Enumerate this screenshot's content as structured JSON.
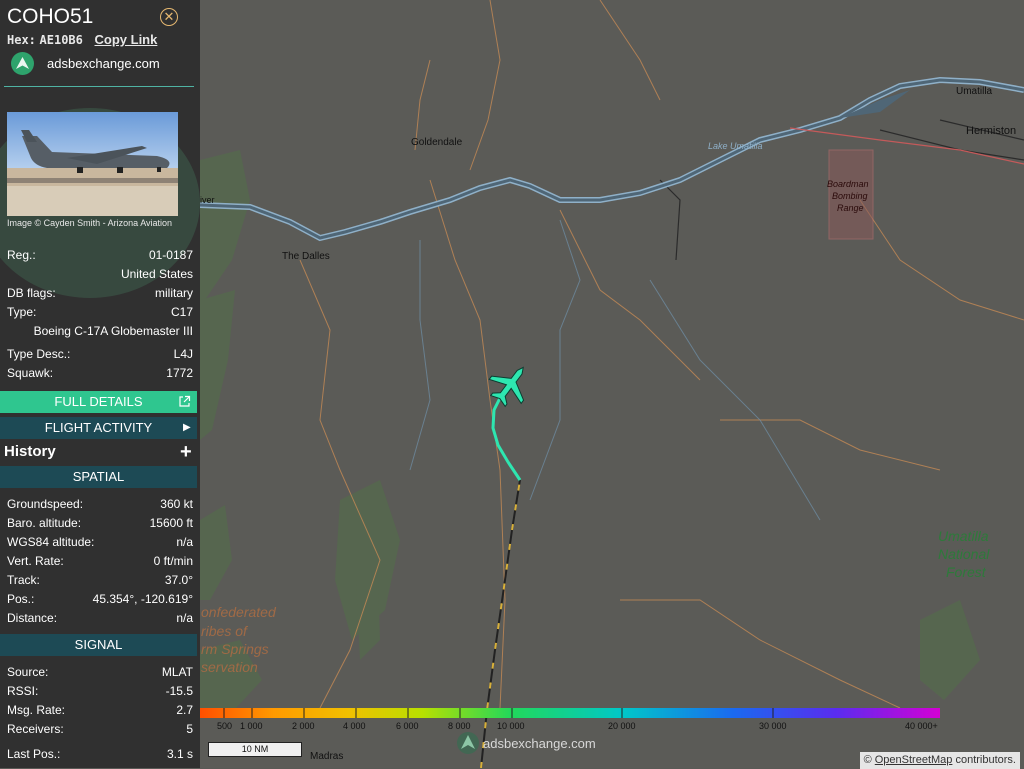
{
  "aircraft": {
    "callsign": "COHO51",
    "hex_label": "Hex:",
    "hex": "AE10B6",
    "copy_link_label": "Copy Link",
    "site_name": "adsbexchange.com",
    "photo_credit": "Image © Cayden Smith - Arizona Aviation"
  },
  "info": {
    "reg_label": "Reg.:",
    "reg": "01-0187",
    "country": "United States",
    "db_flags_label": "DB flags:",
    "db_flags": "military",
    "type_label": "Type:",
    "type": "C17",
    "type_name": "Boeing C-17A Globemaster III",
    "type_desc_label": "Type Desc.:",
    "type_desc": "L4J",
    "squawk_label": "Squawk:",
    "squawk": "1772"
  },
  "buttons": {
    "full_details": "FULL DETAILS",
    "flight_activity": "FLIGHT ACTIVITY",
    "history": "History",
    "history_expand": "+"
  },
  "spatial": {
    "header": "SPATIAL",
    "rows": [
      {
        "label": "Groundspeed:",
        "value": "360 kt"
      },
      {
        "label": "Baro. altitude:",
        "value": "15600 ft"
      },
      {
        "label": "WGS84 altitude:",
        "value": "n/a"
      },
      {
        "label": "Vert. Rate:",
        "value": "0 ft/min"
      },
      {
        "label": "Track:",
        "value": "37.0°"
      },
      {
        "label": "Pos.:",
        "value": "45.354°, -120.619°"
      },
      {
        "label": "Distance:",
        "value": "n/a"
      }
    ]
  },
  "signal": {
    "header": "SIGNAL",
    "rows": [
      {
        "label": "Source:",
        "value": "MLAT"
      },
      {
        "label": "RSSI:",
        "value": "-15.5"
      },
      {
        "label": "Msg. Rate:",
        "value": "2.7"
      },
      {
        "label": "Receivers:",
        "value": "5"
      },
      {
        "label": "Last Pos.:",
        "value": "3.1 s"
      }
    ]
  },
  "map": {
    "places": {
      "goldendale": "Goldendale",
      "the_dalles": "The Dalles",
      "umatilla": "Umatilla",
      "hermiston": "Hermiston",
      "lake_umatilla": "Lake Umatilla",
      "boardman_1": "Boardman",
      "boardman_2": "Bombing",
      "boardman_3": "Range",
      "forest_1": "Umatilla",
      "forest_2": "National",
      "forest_3": "Forest",
      "ws_1": "onfederated",
      "ws_2": "ribes of",
      "ws_3": "rm Springs",
      "ws_4": "servation",
      "madras": "Madras",
      "river_partial": "iver"
    },
    "legend_labels": [
      "500",
      "1 000",
      "2 000",
      "4 000",
      "6 000",
      "8 000",
      "10 000",
      "20 000",
      "30 000",
      "40 000+"
    ],
    "scale_label": "10 NM",
    "logo_text": "adsbexchange.com",
    "attribution_prefix": "© ",
    "attribution_link": "OpenStreetMap",
    "attribution_suffix": " contributors.",
    "colors": {
      "track_mlat": "#2ee6b0",
      "aircraft_icon": "#2ee6b0",
      "accent_green": "#2fc68f",
      "header_teal": "#1d4a55"
    }
  }
}
